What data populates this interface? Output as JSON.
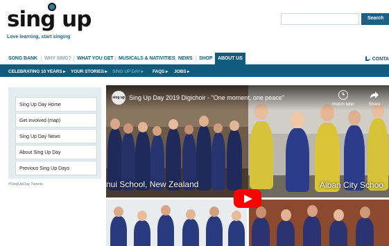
{
  "brand": {
    "logo_text_left": "sin",
    "logo_text_g": "g",
    "logo_text_right": " up",
    "tagline": "Love learning, start singing"
  },
  "search": {
    "button_label": "Search",
    "placeholder": ""
  },
  "main_nav": {
    "items": [
      {
        "label": "SONG BANK"
      },
      {
        "label": "WHY SING?"
      },
      {
        "label": "WHAT YOU GET"
      },
      {
        "label": "MUSICALS & NATIVITIES"
      },
      {
        "label": "NEWS"
      },
      {
        "label": "SHOP"
      },
      {
        "label": "ABOUT US"
      }
    ],
    "contact_label": "CONTA"
  },
  "sub_nav": {
    "items": [
      {
        "label": "CELEBRATING 10 YEARS ▸"
      },
      {
        "label": "YOUR STORIES ▸"
      },
      {
        "label": "SING UP DAY ▸"
      },
      {
        "label": "FAQS ▸"
      },
      {
        "label": "JOBS ▸"
      }
    ]
  },
  "sidebar": {
    "links": [
      {
        "label": "Sing Up Day Home"
      },
      {
        "label": "Get involved (map)"
      },
      {
        "label": "Sing Up Day News"
      },
      {
        "label": "About Sing Up Day"
      },
      {
        "label": "Previous Sing Up Days"
      }
    ],
    "tweets_label": "#SingUpDay Tweets"
  },
  "video": {
    "channel_label": "sing up",
    "title": "Sing Up Day 2019 Digichoir - \"One moment, one peace\"",
    "watch_later_label": "Watch later",
    "share_label": "Share",
    "caption_left": "nui School, New Zealand",
    "caption_right": "Alban City Schoo"
  },
  "colors": {
    "brand_blue": "#0f5c80",
    "youtube_red": "#ff0000",
    "sidebar_bg": "#e3ecef"
  }
}
